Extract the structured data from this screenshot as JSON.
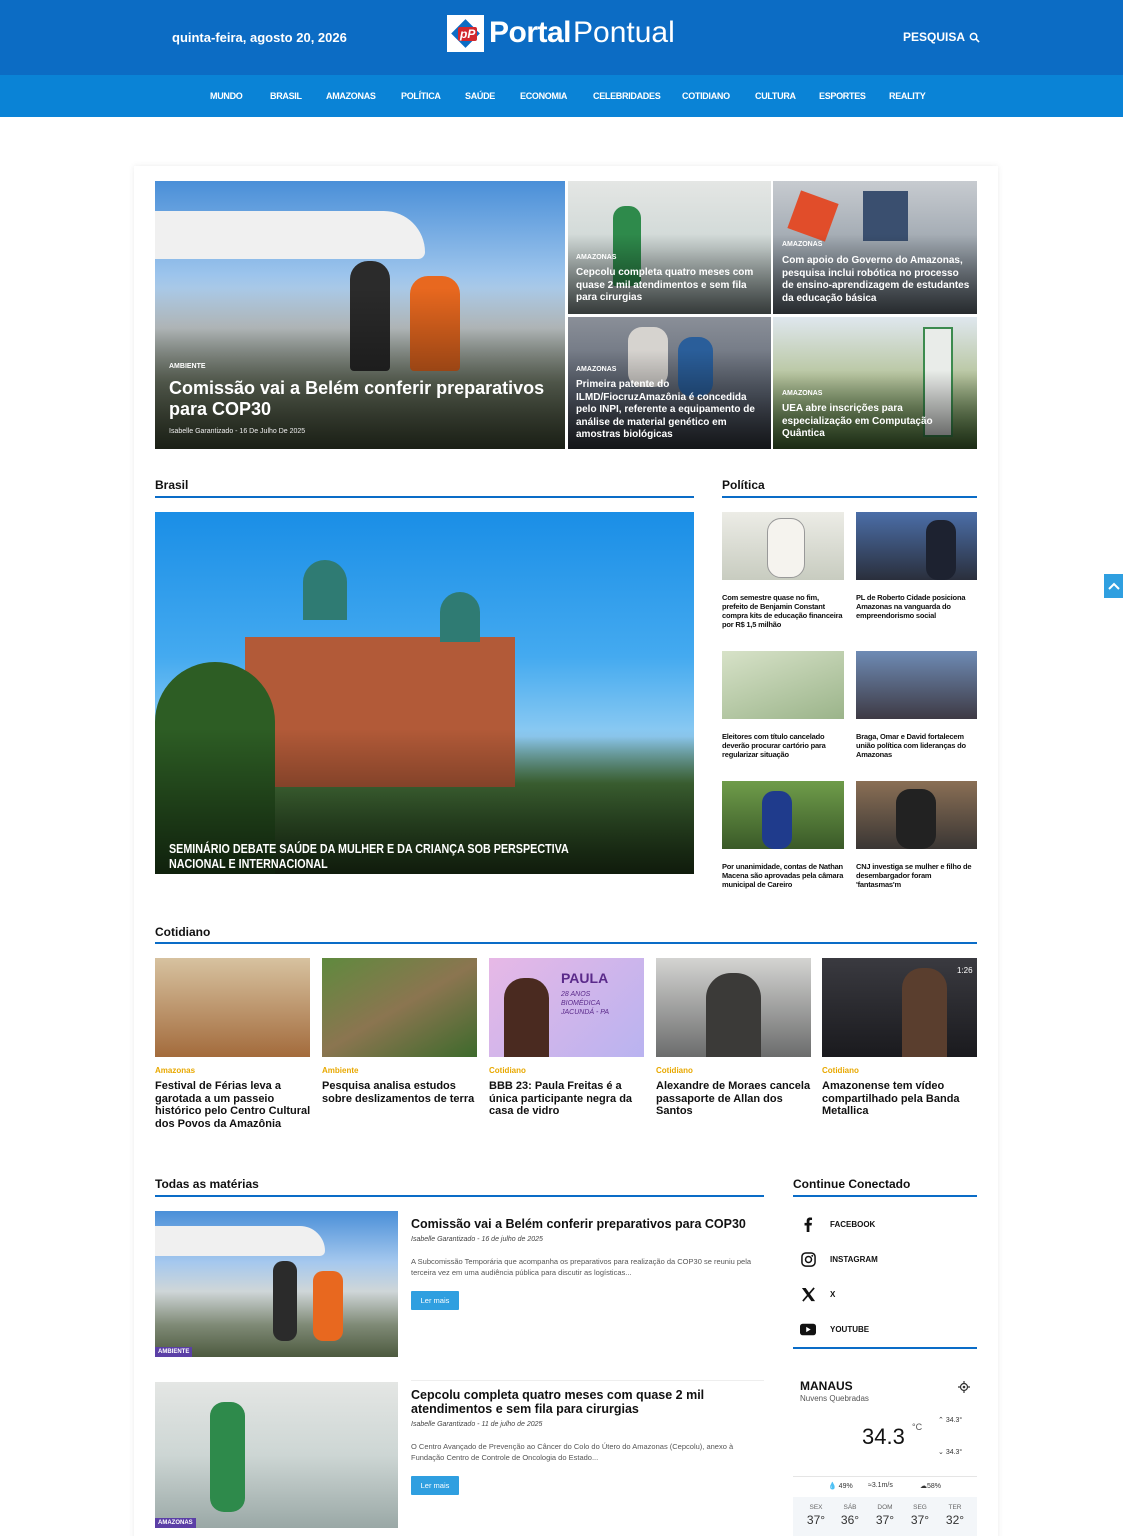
{
  "header": {
    "date": "quinta-feira, agosto 20, 2026",
    "logo_bold": "Portal",
    "logo_light": "Pontual",
    "search_label": "PESQUISA"
  },
  "nav": [
    "MUNDO",
    "BRASIL",
    "AMAZONAS",
    "POLÍTICA",
    "SAÚDE",
    "ECONOMIA",
    "CELEBRIDADES",
    "COTIDIANO",
    "CULTURA",
    "ESPORTES",
    "REALITY"
  ],
  "featured": {
    "main": {
      "category": "AMBIENTE",
      "title": "Comissão vai a Belém conferir preparativos para COP30",
      "meta": "Isabelle Garantizado - 16 De Julho De 2025"
    },
    "tiles": [
      {
        "category": "AMAZONAS",
        "title": "Cepcolu completa quatro meses com quase 2 mil atendimentos e sem fila para cirurgias"
      },
      {
        "category": "AMAZONAS",
        "title": "Com apoio do Governo do Amazonas, pesquisa inclui robótica no processo de ensino-aprendizagem de estudantes da educação básica"
      },
      {
        "category": "AMAZONAS",
        "title": "Primeira patente do ILMD/FiocruzAmazônia é concedida pelo INPI, referente a equipamento de análise de material genético em amostras biológicas"
      },
      {
        "category": "AMAZONAS",
        "title": "UEA abre inscrições para especialização em Computação Quântica"
      }
    ]
  },
  "brasil": {
    "section": "Brasil",
    "headline": "SEMINÁRIO DEBATE SAÚDE DA MULHER E DA CRIANÇA SOB PERSPECTIVA NACIONAL E INTERNACIONAL"
  },
  "politica": {
    "section": "Política",
    "items": [
      "Com semestre quase no fim, prefeito de Benjamin Constant compra kits de educação financeira por R$ 1,5 milhão",
      "PL de Roberto Cidade posiciona Amazonas na vanguarda do empreendorismo social",
      "Eleitores com título cancelado deverão procurar cartório para regularizar situação",
      "Braga, Omar e David fortalecem união política com lideranças do Amazonas",
      "Por unanimidade, contas de Nathan Macena são aprovadas pela câmara municipal de Careiro",
      "CNJ investiga se mulher e filho de desembargador foram 'fantasmas'm"
    ]
  },
  "cotidiano": {
    "section": "Cotidiano",
    "items": [
      {
        "category": "Amazonas",
        "title": "Festival de Férias leva a garotada a um passeio histórico pelo Centro Cultural dos Povos da Amazônia"
      },
      {
        "category": "Ambiente",
        "title": "Pesquisa analisa estudos sobre deslizamentos de terra"
      },
      {
        "category": "Cotidiano",
        "title": "BBB 23: Paula Freitas é a única participante negra da casa de vidro",
        "img_text": "PAULA",
        "img_sub": "28 ANOS\nBIOMÉDICA\nJACUNDÁ - PA"
      },
      {
        "category": "Cotidiano",
        "title": "Alexandre de Moraes cancela passaporte de Allan dos Santos"
      },
      {
        "category": "Cotidiano",
        "title": "Amazonense tem vídeo compartilhado pela Banda Metallica",
        "duration": "1:26"
      }
    ]
  },
  "todas": {
    "section": "Todas as matérias",
    "items": [
      {
        "badge": "AMBIENTE",
        "title": "Comissão vai a Belém conferir preparativos para COP30",
        "author": "Isabelle Garantizado",
        "date": "16 de julho de 2025",
        "excerpt": "A Subcomissão Temporária que acompanha os preparativos para realização da COP30 se reuniu pela terceira vez em uma audiência pública para discutir as logísticas...",
        "button": "Ler mais"
      },
      {
        "badge": "AMAZONAS",
        "title": "Cepcolu completa quatro meses com quase 2 mil atendimentos e sem fila para cirurgias",
        "author": "Isabelle Garantizado",
        "date": "11 de julho de 2025",
        "excerpt": "O Centro Avançado de Prevenção ao Câncer do Colo do Útero do Amazonas (Cepcolu), anexo à Fundação Centro de Controle de Oncologia do Estado...",
        "button": "Ler mais"
      }
    ]
  },
  "conectado": {
    "section": "Continue Conectado",
    "items": [
      "FACEBOOK",
      "INSTAGRAM",
      "X",
      "YOUTUBE"
    ]
  },
  "weather": {
    "city": "MANAUS",
    "desc": "Nuvens Quebradas",
    "temp": "34.3",
    "unit": "°C",
    "max": "34.3°",
    "min": "34.3°",
    "humidity": "49%",
    "wind": "3.1m/s",
    "clouds": "58%",
    "days": [
      {
        "d": "SEX",
        "t": "37°"
      },
      {
        "d": "SÁB",
        "t": "36°"
      },
      {
        "d": "DOM",
        "t": "37°"
      },
      {
        "d": "SEG",
        "t": "37°"
      },
      {
        "d": "TER",
        "t": "32°"
      }
    ]
  },
  "colors": {
    "header": "#0c6cc4",
    "nav": "#0a83d6",
    "accent": "#0a6cc7",
    "category_gold": "#e8a800"
  }
}
